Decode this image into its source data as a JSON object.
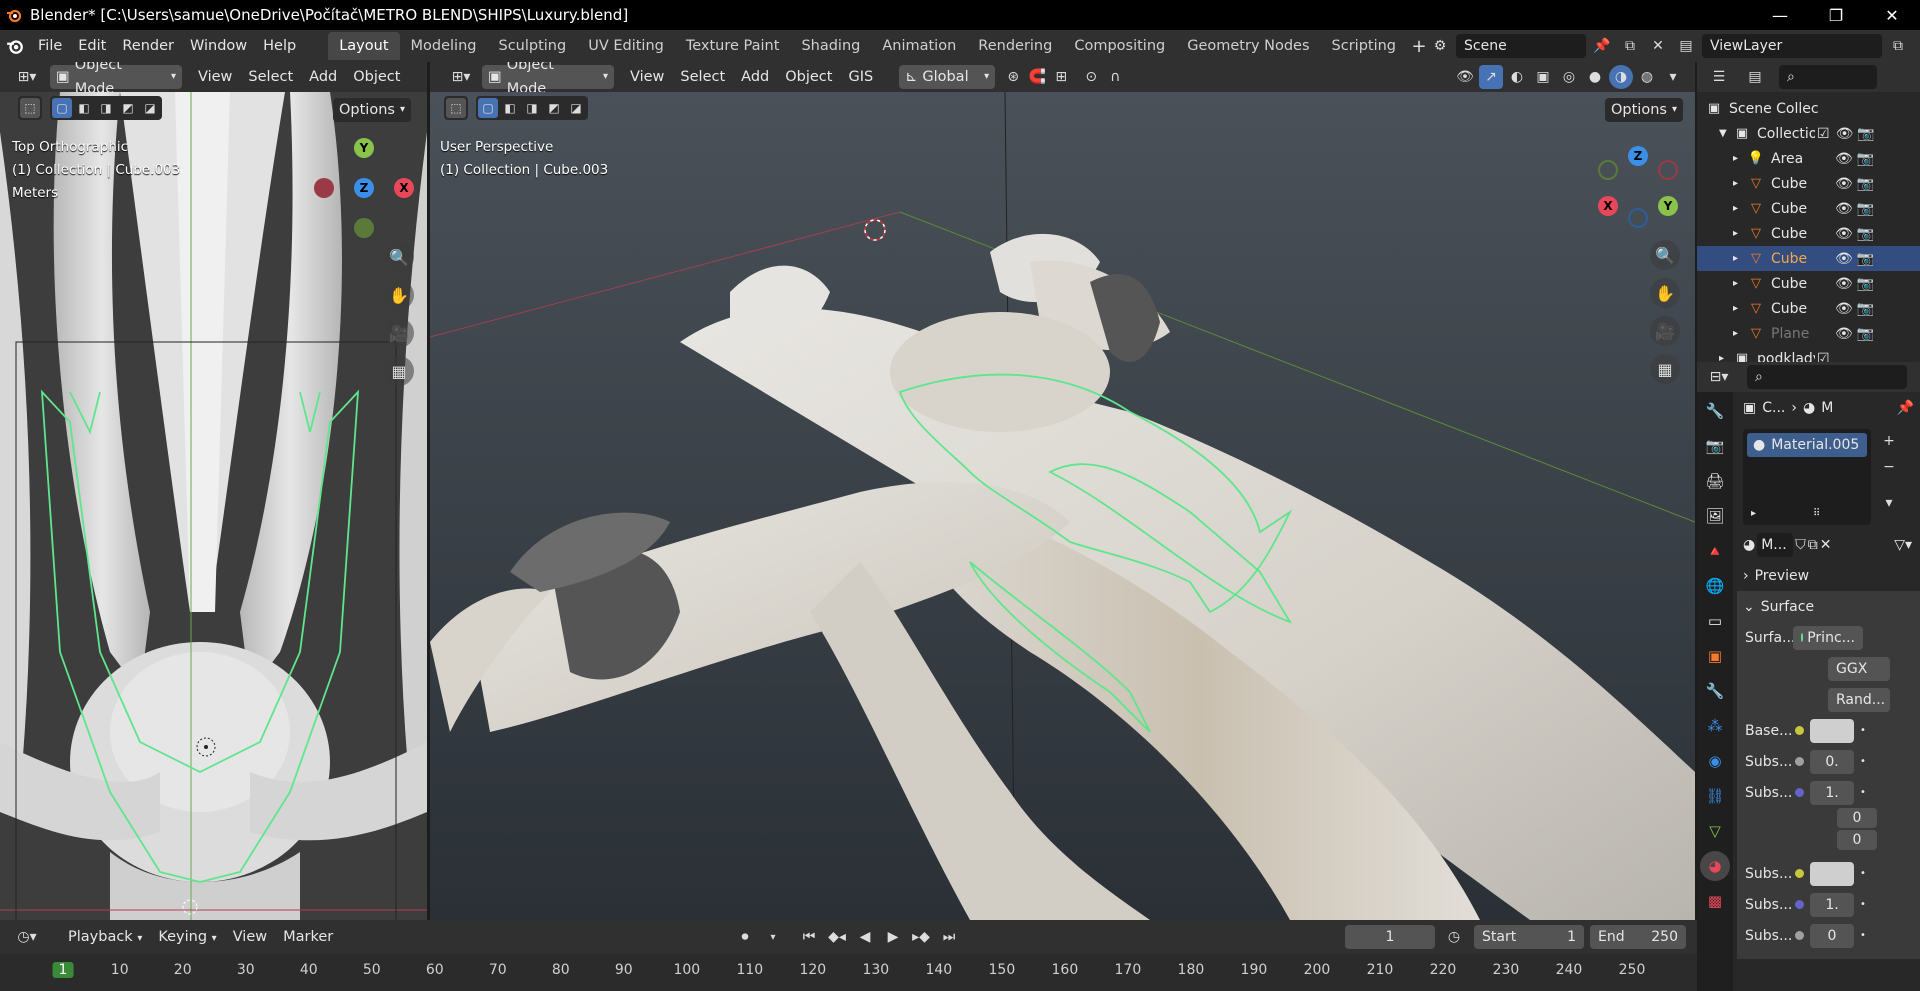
{
  "window": {
    "title": "Blender* [C:\\Users\\samue\\OneDrive\\Počítač\\METRO BLEND\\SHIPS\\Luxury.blend]",
    "minimize": "—",
    "maximize": "❐",
    "close": "✕"
  },
  "menus": [
    "File",
    "Edit",
    "Render",
    "Window",
    "Help"
  ],
  "workspaces": [
    "Layout",
    "Modeling",
    "Sculpting",
    "UV Editing",
    "Texture Paint",
    "Shading",
    "Animation",
    "Rendering",
    "Compositing",
    "Geometry Nodes",
    "Scripting"
  ],
  "active_workspace": "Layout",
  "scene": {
    "name": "Scene",
    "view_layer": "ViewLayer"
  },
  "left_view": {
    "mode": "Object Mode",
    "menus": [
      "View",
      "Select",
      "Add",
      "Object"
    ],
    "options": "Options",
    "info": [
      "Top Orthographic",
      "(1) Collection | Cube.003",
      "Meters"
    ]
  },
  "main_view": {
    "mode": "Object Mode",
    "menus": [
      "View",
      "Select",
      "Add",
      "Object",
      "GIS"
    ],
    "transform_orientation": "Global",
    "options": "Options",
    "info": [
      "User Perspective",
      "(1) Collection | Cube.003"
    ]
  },
  "gizmo_labels": {
    "x": "X",
    "y": "Y",
    "z": "Z"
  },
  "outliner": {
    "root": "Scene Collec",
    "collection": "Collectio",
    "items": [
      {
        "name": "Area",
        "type": "light",
        "selected": false
      },
      {
        "name": "Cube",
        "type": "mesh",
        "selected": false
      },
      {
        "name": "Cube",
        "type": "mesh",
        "selected": false
      },
      {
        "name": "Cube",
        "type": "mesh",
        "selected": false
      },
      {
        "name": "Cube",
        "type": "mesh",
        "selected": true
      },
      {
        "name": "Cube",
        "type": "mesh",
        "selected": false
      },
      {
        "name": "Cube",
        "type": "mesh",
        "selected": false
      },
      {
        "name": "Plane",
        "type": "mesh",
        "selected": false
      }
    ],
    "next_collection": "podklady"
  },
  "properties": {
    "breadcrumb": [
      "C...",
      "M"
    ],
    "material_slot": "Material.005",
    "material_short": "M...",
    "panels": {
      "preview": "Preview",
      "surface": "Surface"
    },
    "surface_label": "Surfa...",
    "surface_value": "Princ...",
    "distribution": "GGX",
    "subsurface_method": "Rand...",
    "rows": [
      {
        "label": "Base...",
        "value": "",
        "dot": "#c8c83c"
      },
      {
        "label": "Subs...",
        "value": "0.",
        "dot": "#a0a0a0"
      },
      {
        "label": "Subs...",
        "value": "1.",
        "dot": "#6464c8"
      }
    ],
    "vector_extra": [
      "0",
      "0"
    ],
    "rows_after": [
      {
        "label": "Subs...",
        "value": "",
        "dot": "#c8c83c"
      },
      {
        "label": "Subs...",
        "value": "1.",
        "dot": "#6464c8"
      },
      {
        "label": "Subs...",
        "value": "0",
        "dot": "#a0a0a0"
      }
    ]
  },
  "timeline": {
    "menus": [
      "Playback",
      "Keying",
      "View",
      "Marker"
    ],
    "current_frame": "1",
    "start_label": "Start",
    "start": "1",
    "end_label": "End",
    "end": "250",
    "ruler": [
      "1",
      "10",
      "20",
      "30",
      "40",
      "50",
      "60",
      "70",
      "80",
      "90",
      "100",
      "110",
      "120",
      "130",
      "140",
      "150",
      "160",
      "170",
      "180",
      "190",
      "200",
      "210",
      "220",
      "230",
      "240",
      "250"
    ]
  },
  "colors": {
    "accent": "#4772b3",
    "selection_outline": "#5ee68a",
    "axis_x": "#e8475a",
    "axis_y": "#8bc34a",
    "axis_z": "#3a8fe8"
  }
}
